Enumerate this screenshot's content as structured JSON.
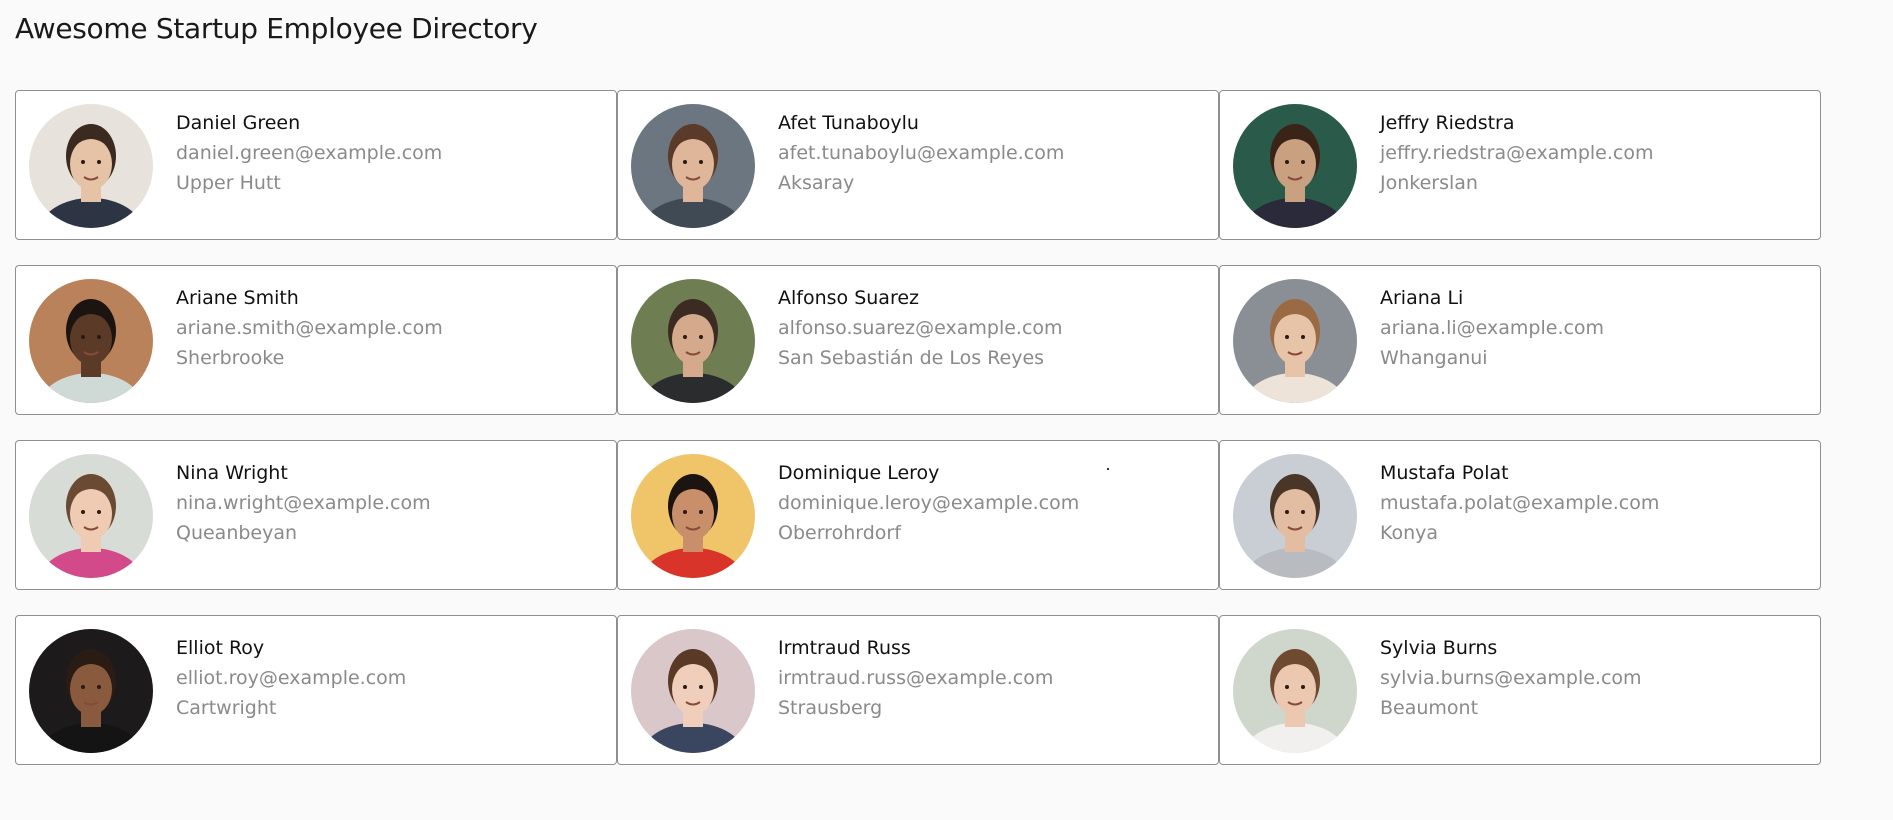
{
  "page": {
    "title": "Awesome Startup Employee Directory"
  },
  "employees": [
    {
      "name": "Daniel Green",
      "email": "daniel.green@example.com",
      "city": "Upper Hutt",
      "bg": "#e8e2dc",
      "skin": "#e6c2a6",
      "hair": "#3a2a20",
      "shirt": "#2d3444"
    },
    {
      "name": "Afet Tunaboylu",
      "email": "afet.tunaboylu@example.com",
      "city": "Aksaray",
      "bg": "#6b7680",
      "skin": "#e0b69a",
      "hair": "#5a3a28",
      "shirt": "#3f4a55"
    },
    {
      "name": "Jeffry Riedstra",
      "email": "jeffry.riedstra@example.com",
      "city": "Jonkerslan",
      "bg": "#2a5a4a",
      "skin": "#c9a080",
      "hair": "#3a2418",
      "shirt": "#2a2a3a"
    },
    {
      "name": "Ariane Smith",
      "email": "ariane.smith@example.com",
      "city": "Sherbrooke",
      "bg": "#b9825a",
      "skin": "#5b3a28",
      "hair": "#1b1410",
      "shirt": "#cfd9d6"
    },
    {
      "name": "Alfonso Suarez",
      "email": "alfonso.suarez@example.com",
      "city": "San Sebastián de Los Reyes",
      "bg": "#6f7d52",
      "skin": "#d4a98c",
      "hair": "#3b2b22",
      "shirt": "#2a2c2e"
    },
    {
      "name": "Ariana Li",
      "email": "ariana.li@example.com",
      "city": "Whanganui",
      "bg": "#8a8f95",
      "skin": "#e7c3a8",
      "hair": "#9a6a44",
      "shirt": "#ede3d8"
    },
    {
      "name": "Nina Wright",
      "email": "nina.wright@example.com",
      "city": "Queanbeyan",
      "bg": "#d8dcd6",
      "skin": "#efcbb4",
      "hair": "#6a4a32",
      "shirt": "#d34a8a"
    },
    {
      "name": "Dominique Leroy",
      "email": "dominique.leroy@example.com",
      "city": "Oberrohrdorf",
      "bg": "#f0c56a",
      "skin": "#c98f6a",
      "hair": "#1c1410",
      "shirt": "#d8342a"
    },
    {
      "name": "Mustafa Polat",
      "email": "mustafa.polat@example.com",
      "city": "Konya",
      "bg": "#c9ced4",
      "skin": "#e3bda2",
      "hair": "#4a3628",
      "shirt": "#b8bcc0"
    },
    {
      "name": "Elliot Roy",
      "email": "elliot.roy@example.com",
      "city": "Cartwright",
      "bg": "#1c1a1a",
      "skin": "#8a5a3e",
      "hair": "#2a1c14",
      "shirt": "#141414"
    },
    {
      "name": "Irmtraud Russ",
      "email": "irmtraud.russ@example.com",
      "city": "Strausberg",
      "bg": "#d9c7c9",
      "skin": "#efcfbb",
      "hair": "#5a3a26",
      "shirt": "#3a4660"
    },
    {
      "name": "Sylvia Burns",
      "email": "sylvia.burns@example.com",
      "city": "Beaumont",
      "bg": "#cfd6cc",
      "skin": "#ecc8b0",
      "hair": "#6e4a30",
      "shirt": "#f2f0ee"
    }
  ]
}
